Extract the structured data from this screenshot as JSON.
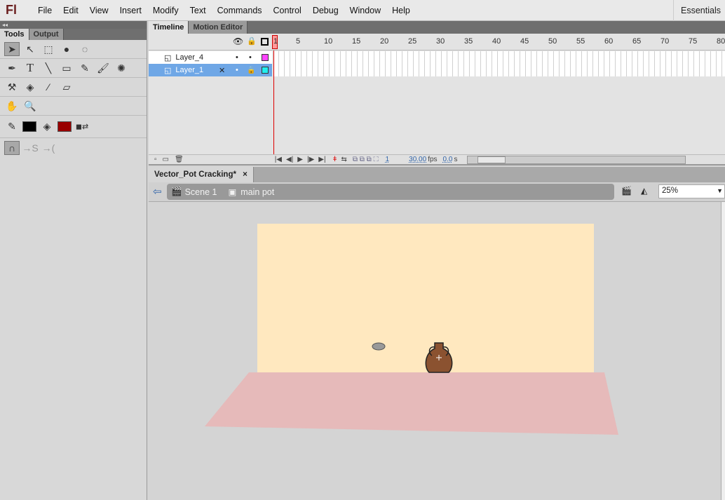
{
  "app": {
    "logo": "Fl",
    "workspace": "Essentials"
  },
  "menu": [
    "File",
    "Edit",
    "View",
    "Insert",
    "Modify",
    "Text",
    "Commands",
    "Control",
    "Debug",
    "Window",
    "Help"
  ],
  "tools_panel": {
    "tabs": [
      "Tools",
      "Output"
    ],
    "stroke_color": "#000000",
    "fill_color": "#990000"
  },
  "timeline": {
    "tabs": [
      "Timeline",
      "Motion Editor"
    ],
    "layers": [
      {
        "name": "Layer_4",
        "color": "#ff44ff",
        "selected": false
      },
      {
        "name": "Layer_1",
        "color": "#22eeee",
        "selected": true
      }
    ],
    "frame_numbers": [
      "1",
      "5",
      "10",
      "15",
      "20",
      "25",
      "30",
      "35",
      "40",
      "45",
      "50",
      "55",
      "60",
      "65",
      "70",
      "75",
      "80"
    ],
    "current_frame": "1",
    "fps": "30.00",
    "fps_unit": "fps",
    "time": "0.0",
    "time_unit": "s"
  },
  "document": {
    "tab": "Vector_Pot Cracking*",
    "close": "×",
    "breadcrumb": [
      "Scene 1",
      "main pot"
    ],
    "zoom": "25%"
  },
  "colors": {
    "stage": "#ffe8bf",
    "floor": "#e6baba",
    "pot": "#8b5230"
  }
}
